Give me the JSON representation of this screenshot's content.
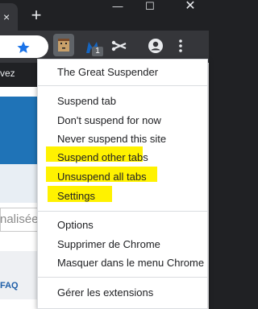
{
  "browser": {
    "tab_close_glyph": "×",
    "new_tab_glyph": "+",
    "window": {
      "minimize": "—",
      "maximize": "☐",
      "close": "✕"
    },
    "extension_badge": "1"
  },
  "page": {
    "bookmark_text": "vez",
    "search_placeholder": "nalisée",
    "faq_text": "FAQ"
  },
  "menu": {
    "title": "The Great Suspender",
    "group1": [
      {
        "label": "Suspend tab",
        "highlighted": false
      },
      {
        "label": "Don't suspend for now",
        "highlighted": false
      },
      {
        "label": "Never suspend this site",
        "highlighted": false
      },
      {
        "label": "Suspend other tabs",
        "highlighted": true
      },
      {
        "label": "Unsuspend all tabs",
        "highlighted": true
      },
      {
        "label": "Settings",
        "highlighted": true
      }
    ],
    "group2": [
      {
        "label": "Options"
      },
      {
        "label": "Supprimer de Chrome"
      },
      {
        "label": "Masquer dans le menu Chrome"
      }
    ],
    "group3": [
      {
        "label": "Gérer les extensions"
      }
    ]
  },
  "colors": {
    "highlight": "#fff200",
    "chrome_dark": "#202124",
    "toolbar": "#35363a",
    "page_blue": "#1f73b7",
    "link_blue": "#1f5fa8"
  }
}
